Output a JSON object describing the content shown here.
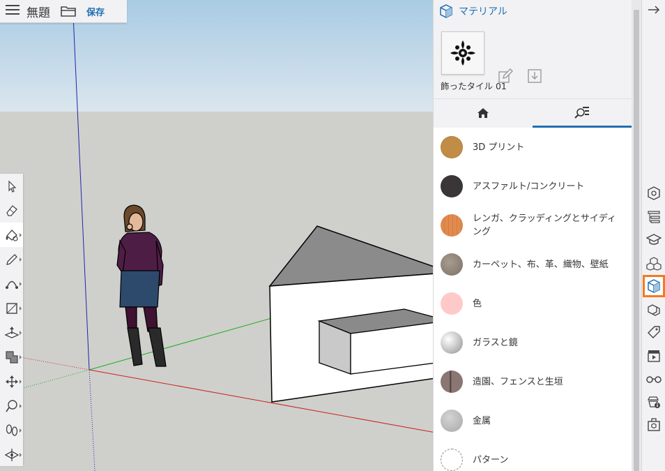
{
  "app": {
    "document_title": "無題",
    "save_label": "保存"
  },
  "left_toolbar": {
    "tools": [
      {
        "name": "select-tool",
        "icon": "arrow-cursor-icon"
      },
      {
        "name": "eraser-tool",
        "icon": "eraser-icon"
      },
      {
        "name": "paint-bucket-tool",
        "icon": "paint-icon",
        "active": true
      },
      {
        "name": "pencil-tool",
        "icon": "pencil-icon"
      },
      {
        "name": "arc-tool",
        "icon": "arc-icon"
      },
      {
        "name": "rectangle-tool",
        "icon": "rectangle-icon"
      },
      {
        "name": "push-pull-tool",
        "icon": "push-pull-icon"
      },
      {
        "name": "offset-tool",
        "icon": "offset-icon"
      },
      {
        "name": "move-tool",
        "icon": "move-icon"
      },
      {
        "name": "tape-measure-tool",
        "icon": "tape-measure-icon"
      },
      {
        "name": "walk-tool",
        "icon": "footprints-icon"
      },
      {
        "name": "section-tool",
        "icon": "section-plane-icon"
      }
    ]
  },
  "material_panel": {
    "title": "マテリアル",
    "current_material": "飾ったタイル 01",
    "tabs": [
      {
        "name": "home",
        "icon": "home-icon"
      },
      {
        "name": "browse",
        "icon": "search-materials-icon",
        "selected": true
      }
    ],
    "categories": [
      {
        "label": "3D プリント",
        "color": "#c18c45"
      },
      {
        "label": "アスファルト/コンクリート",
        "color": "#3a3637"
      },
      {
        "label": "レンガ、クラッディングとサイディング",
        "color": "#e08a4e"
      },
      {
        "label": "カーペット、布、革、織物、壁紙",
        "color": "#8f8276"
      },
      {
        "label": "色",
        "color": "#ffc9c9"
      },
      {
        "label": "ガラスと鏡",
        "color": "#bdbdbd"
      },
      {
        "label": "造園、フェンスと生垣",
        "color": "#7d6a66"
      },
      {
        "label": "金属",
        "color": "#b8b8b8"
      },
      {
        "label": "パターン",
        "color": "#ffffff"
      }
    ]
  },
  "right_strip": {
    "icons": [
      {
        "name": "entity-info-icon"
      },
      {
        "name": "outliner-icon"
      },
      {
        "name": "instructor-icon"
      },
      {
        "name": "components-icon"
      },
      {
        "name": "materials-icon",
        "active": true
      },
      {
        "name": "styles-icon"
      },
      {
        "name": "tags-icon"
      },
      {
        "name": "scenes-icon"
      },
      {
        "name": "display-icon"
      },
      {
        "name": "model-info-icon"
      },
      {
        "name": "3d-warehouse-icon"
      }
    ]
  },
  "colors": {
    "accent": "#1f6fb2",
    "active_outline": "#f47a20",
    "sky": "#c2dbeb",
    "ground": "#cfd0cc"
  }
}
